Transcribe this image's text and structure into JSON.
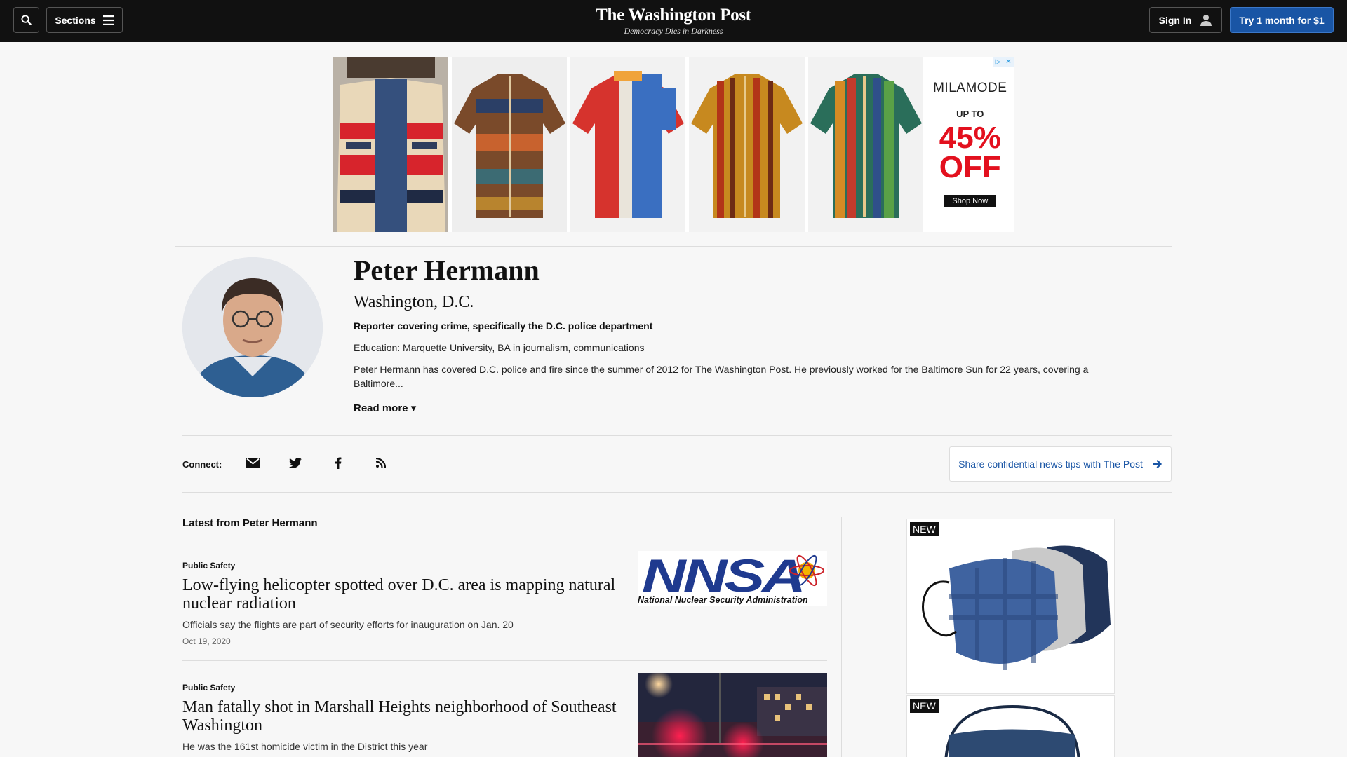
{
  "header": {
    "sections_label": "Sections",
    "logo": "The Washington Post",
    "tagline": "Democracy Dies in Darkness",
    "signin_label": "Sign In",
    "subscribe_label": "Try 1 month for $1"
  },
  "top_ad": {
    "brand": "MILAMODE",
    "up_to": "UP TO",
    "discount": "45% OFF",
    "cta": "Shop Now"
  },
  "author": {
    "name": "Peter Hermann",
    "location": "Washington, D.C.",
    "role": "Reporter covering crime, specifically the D.C. police department",
    "education": "Education: Marquette University, BA in journalism, communications",
    "bio": "Peter Hermann has covered D.C. police and fire since the summer of 2012 for The Washington Post. He previously worked for the Baltimore Sun for 22 years, covering a Baltimore...",
    "read_more": "Read more"
  },
  "connect": {
    "label": "Connect:",
    "icons": [
      "email-icon",
      "twitter-icon",
      "facebook-icon",
      "rss-icon"
    ],
    "tips_label": "Share confidential news tips with The Post"
  },
  "latest": {
    "heading": "Latest from Peter Hermann",
    "stories": [
      {
        "kicker": "Public Safety",
        "headline": "Low-flying helicopter spotted over D.C. area is mapping natural nuclear radiation",
        "blurb": "Officials say the flights are part of security efforts for inauguration on Jan. 20",
        "date": "Oct 19, 2020",
        "image_logo_text": "NNSA",
        "image_caption": "National Nuclear Security Administration"
      },
      {
        "kicker": "Public Safety",
        "headline": "Man fatally shot in Marshall Heights neighborhood of Southeast Washington",
        "blurb": "He was the 161st homicide victim in the District this year"
      }
    ]
  },
  "right_ad": {
    "badge_1": "NEW",
    "badge_2": "NEW"
  },
  "colors": {
    "nav_bg": "#111111",
    "subscribe_blue": "#1955a5",
    "link_blue": "#1955a5",
    "page_bg": "#f7f7f7",
    "ad_red": "#e3101e"
  }
}
